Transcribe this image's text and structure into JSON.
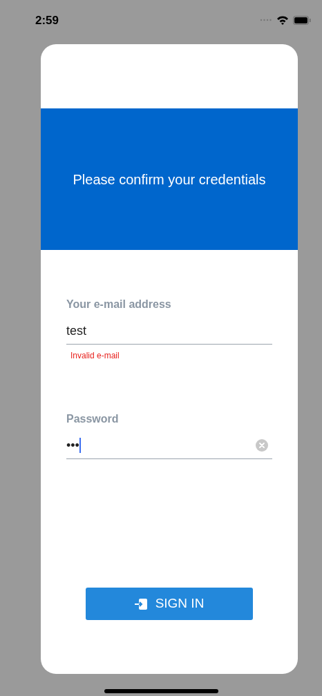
{
  "status_bar": {
    "time": "2:59"
  },
  "header": {
    "title": "Please confirm your credentials"
  },
  "fields": [
    {
      "label": "Your e-mail address",
      "value": "test",
      "error": "Invalid e-mail",
      "focused": false,
      "clear_button": false
    },
    {
      "label": "Password",
      "value": "•••",
      "focused": true,
      "clear_button": true
    }
  ],
  "sign_in_button": {
    "label": "SIGN IN"
  }
}
